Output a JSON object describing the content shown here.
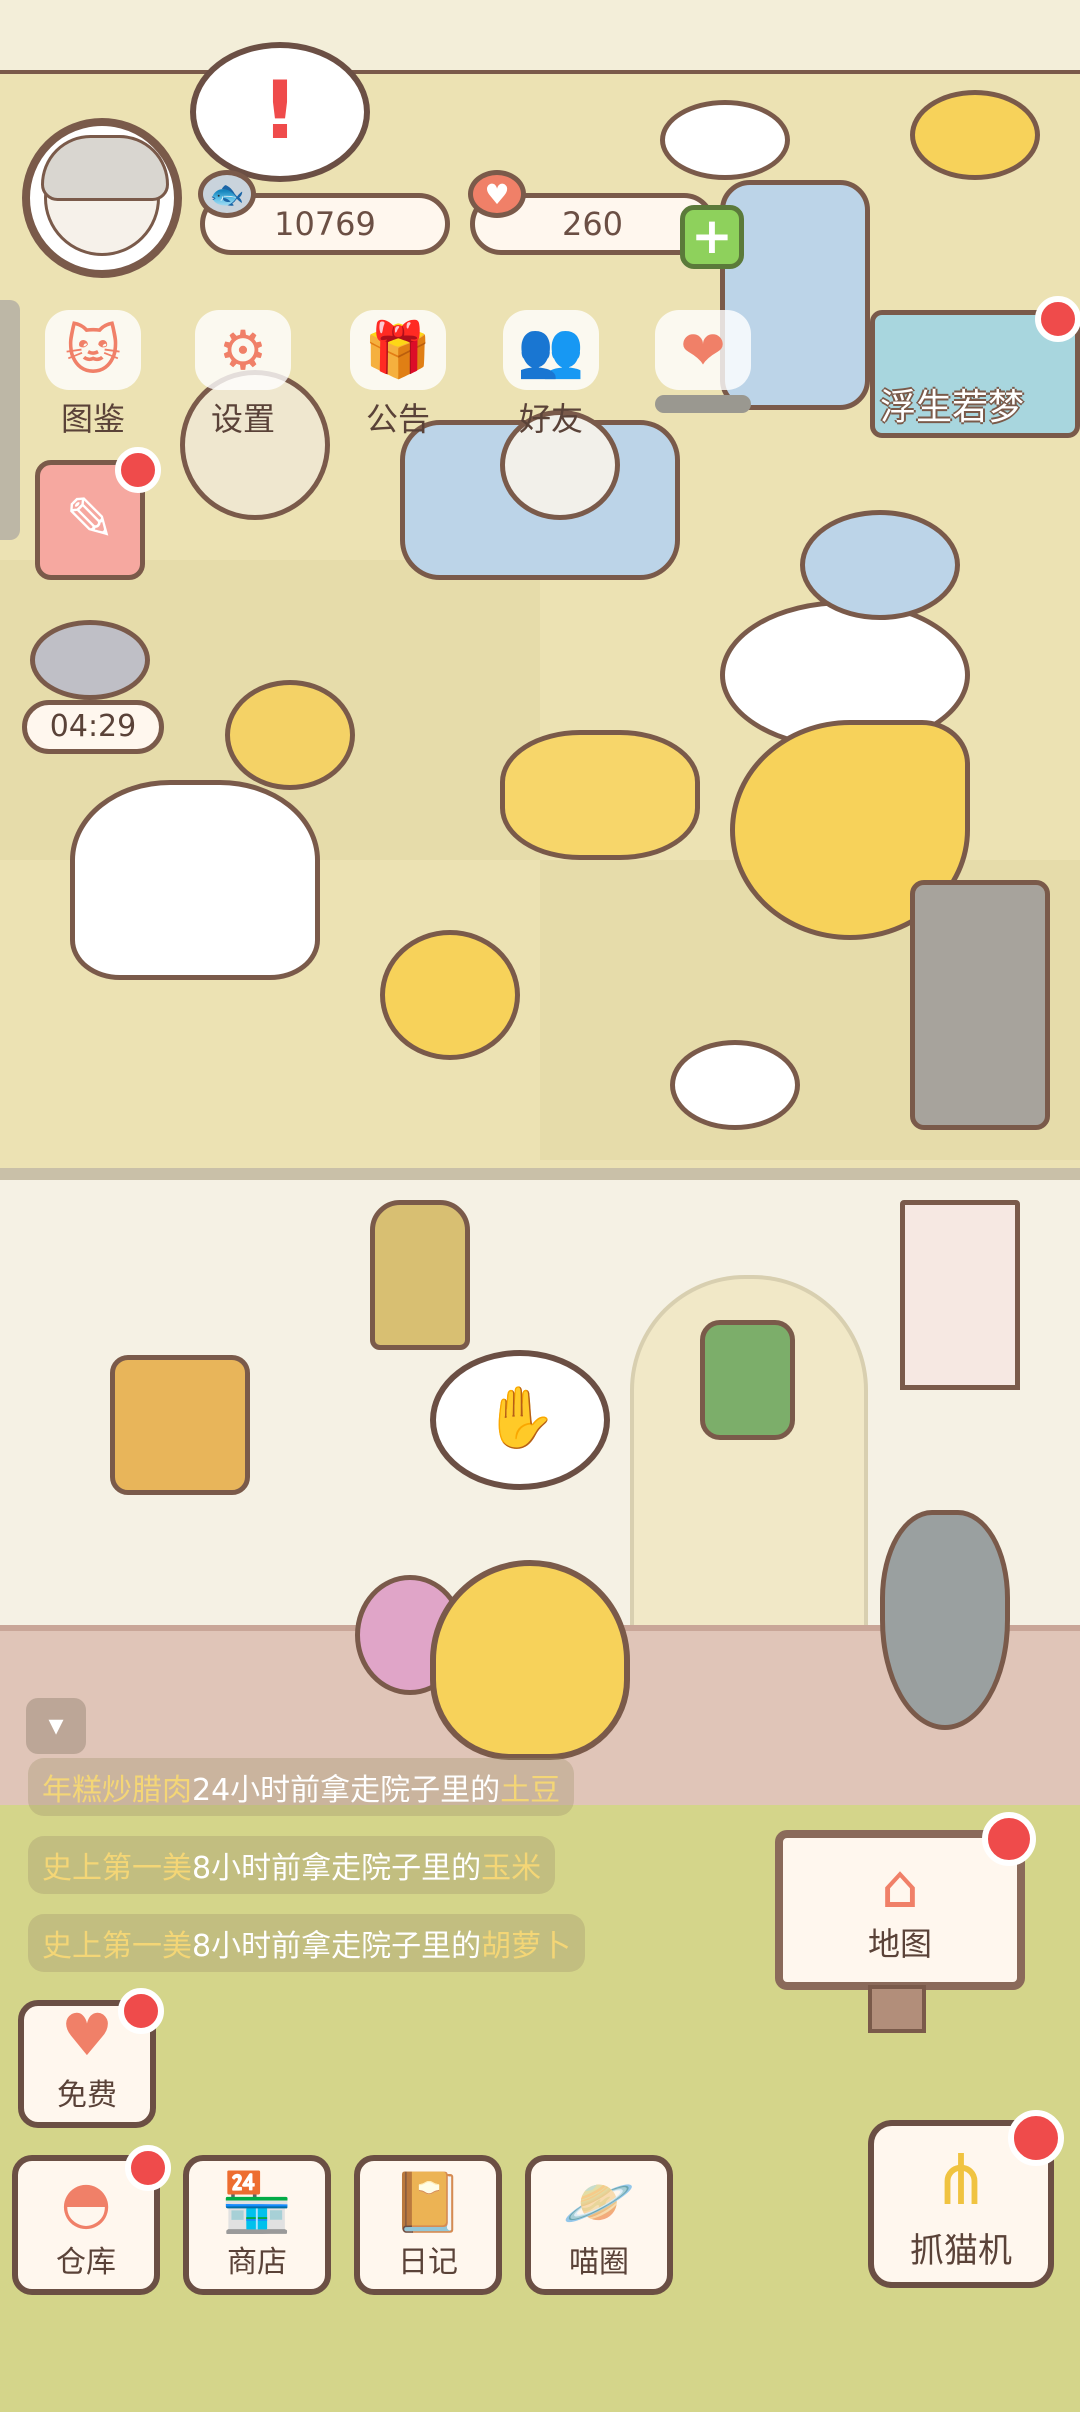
{
  "hud": {
    "currency_fish": "10769",
    "currency_heart": "260",
    "fish_icon": "fish-icon",
    "heart_icon": "heart-icon",
    "top_buttons": [
      {
        "label": "图鉴",
        "icon": "cat-book-icon"
      },
      {
        "label": "设置",
        "icon": "gear-icon"
      },
      {
        "label": "公告",
        "icon": "gift-icon"
      },
      {
        "label": "好友",
        "icon": "friends-icon"
      },
      {
        "label": "",
        "icon": "hearts-icon"
      }
    ],
    "event_tag": "浮生若梦",
    "timer": "04:29"
  },
  "feed": [
    {
      "user": "年糕炒腊肉",
      "text": "24小时前拿走院子里的",
      "item": "土豆"
    },
    {
      "user": "史上第一美",
      "text": "8小时前拿走院子里的",
      "item": "玉米"
    },
    {
      "user": "史上第一美",
      "text": "8小时前拿走院子里的",
      "item": "胡萝卜"
    }
  ],
  "bottom": {
    "free_label": "免费",
    "warehouse_label": "仓库",
    "shop_label": "商店",
    "diary_label": "日记",
    "circle_label": "喵圈",
    "map_label": "地图",
    "claw_label": "抓猫机"
  },
  "colors": {
    "accent": "#f08068",
    "notify": "#ef4b4b",
    "outline": "#7a5a4a"
  }
}
